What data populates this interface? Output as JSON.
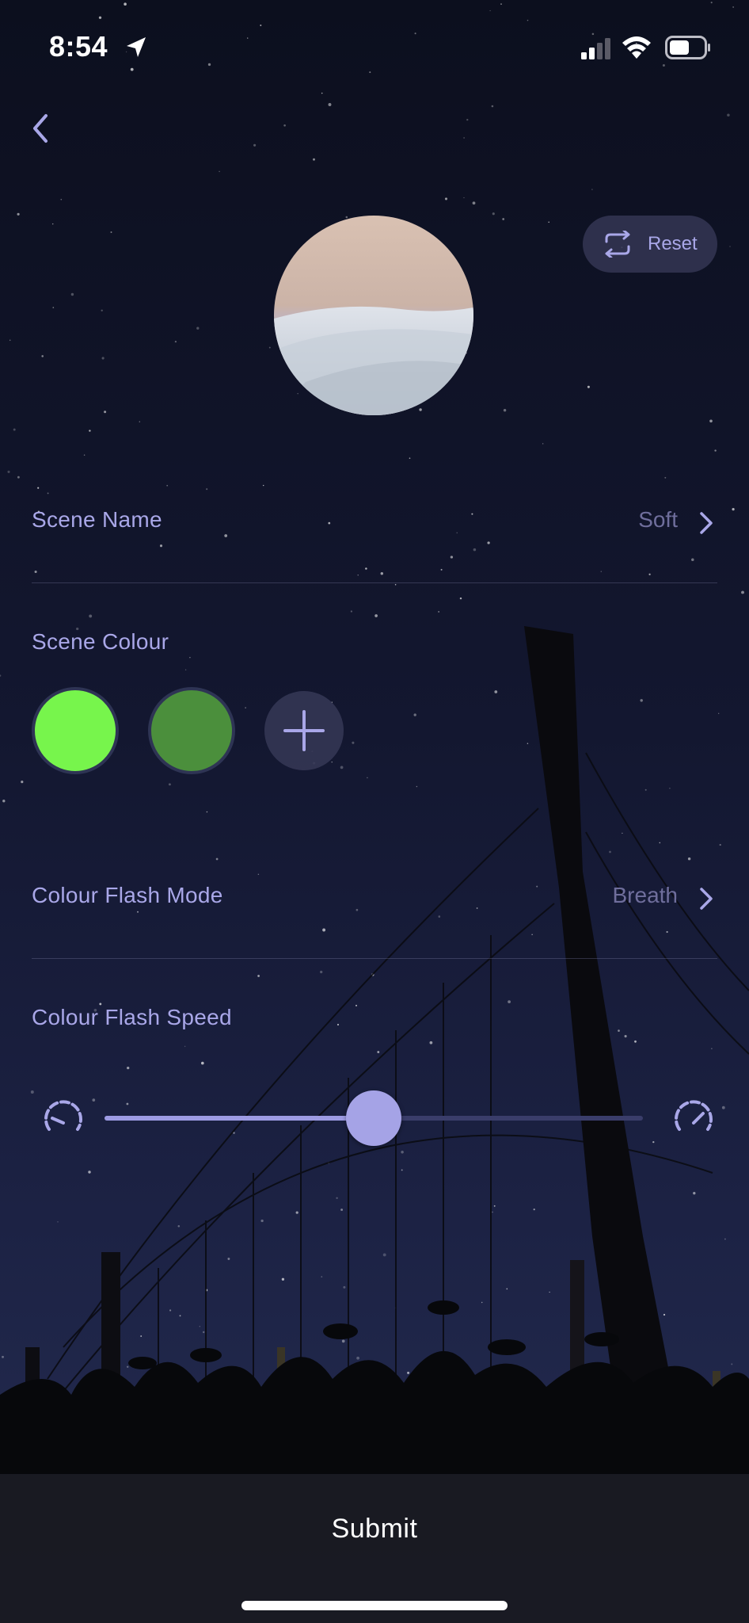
{
  "status_bar": {
    "time": "8:54"
  },
  "header": {
    "reset_label": "Reset"
  },
  "scene_name": {
    "label": "Scene Name",
    "value": "Soft"
  },
  "scene_colour": {
    "label": "Scene Colour",
    "swatches": [
      {
        "color": "#77f54c"
      },
      {
        "color": "#4b8f3c"
      }
    ]
  },
  "flash_mode": {
    "label": "Colour Flash Mode",
    "value": "Breath"
  },
  "flash_speed": {
    "label": "Colour Flash Speed",
    "value_fraction": 0.5
  },
  "footer": {
    "submit_label": "Submit"
  },
  "colors": {
    "accent": "#a9a7e8",
    "muted": "#6f6e9c"
  }
}
